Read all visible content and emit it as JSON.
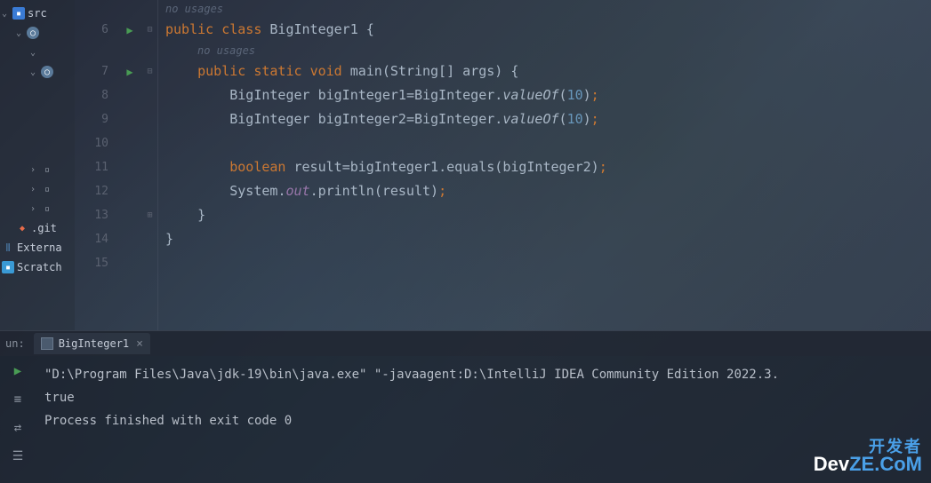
{
  "sidebar": {
    "items": [
      {
        "label": "src",
        "icon": "folder"
      },
      {
        "label": "",
        "icon": "circle"
      },
      {
        "label": "",
        "icon": ""
      },
      {
        "label": "",
        "icon": "circle"
      },
      {
        "label": "",
        "icon": ""
      },
      {
        "label": "",
        "icon": ""
      },
      {
        "label": "",
        "icon": ""
      },
      {
        "label": "",
        "icon": ""
      },
      {
        "label": ".git",
        "icon": "git"
      },
      {
        "label": "Externa",
        "icon": "ext"
      },
      {
        "label": "Scratch",
        "icon": "scratch"
      }
    ]
  },
  "editor": {
    "hint_no_usages": "no usages",
    "line_numbers": [
      "6",
      "7",
      "8",
      "9",
      "10",
      "11",
      "12",
      "13",
      "14",
      "15"
    ],
    "code": {
      "l6": {
        "kw1": "public",
        "kw2": "class",
        "name": "BigInteger1",
        "brace": "{"
      },
      "l7": {
        "kw1": "public",
        "kw2": "static",
        "kw3": "void",
        "method": "main",
        "params": "(String[] args)",
        "brace": "{"
      },
      "l8": {
        "type": "BigInteger",
        "var": "bigInteger1",
        "assign": "=",
        "cls": "BigInteger",
        "dot": ".",
        "call": "valueOf",
        "open": "(",
        "num": "10",
        "close": ")",
        "semi": ";"
      },
      "l9": {
        "type": "BigInteger",
        "var": "bigInteger2",
        "assign": "=",
        "cls": "BigInteger",
        "dot": ".",
        "call": "valueOf",
        "open": "(",
        "num": "10",
        "close": ")",
        "semi": ";"
      },
      "l11": {
        "kw": "boolean",
        "var": "result",
        "assign": "=",
        "obj": "bigInteger1",
        "dot": ".",
        "call": "equals",
        "open": "(",
        "arg": "bigInteger2",
        "close": ")",
        "semi": ";"
      },
      "l12": {
        "cls": "System",
        "dot1": ".",
        "field": "out",
        "dot2": ".",
        "call": "println",
        "open": "(",
        "arg": "result",
        "close": ")",
        "semi": ";"
      },
      "l13": {
        "brace": "}"
      },
      "l14": {
        "brace": "}"
      }
    }
  },
  "run": {
    "label": "un:",
    "tab_name": "BigInteger1",
    "console_line1": "\"D:\\Program Files\\Java\\jdk-19\\bin\\java.exe\" \"-javaagent:D:\\IntelliJ IDEA Community Edition 2022.3.",
    "console_line2": "true",
    "console_line3": "",
    "console_line4": "Process finished with exit code 0"
  },
  "watermark": {
    "top": "开发者",
    "bot_dev": "Dev",
    "bot_rest": "ZE.CoM"
  }
}
